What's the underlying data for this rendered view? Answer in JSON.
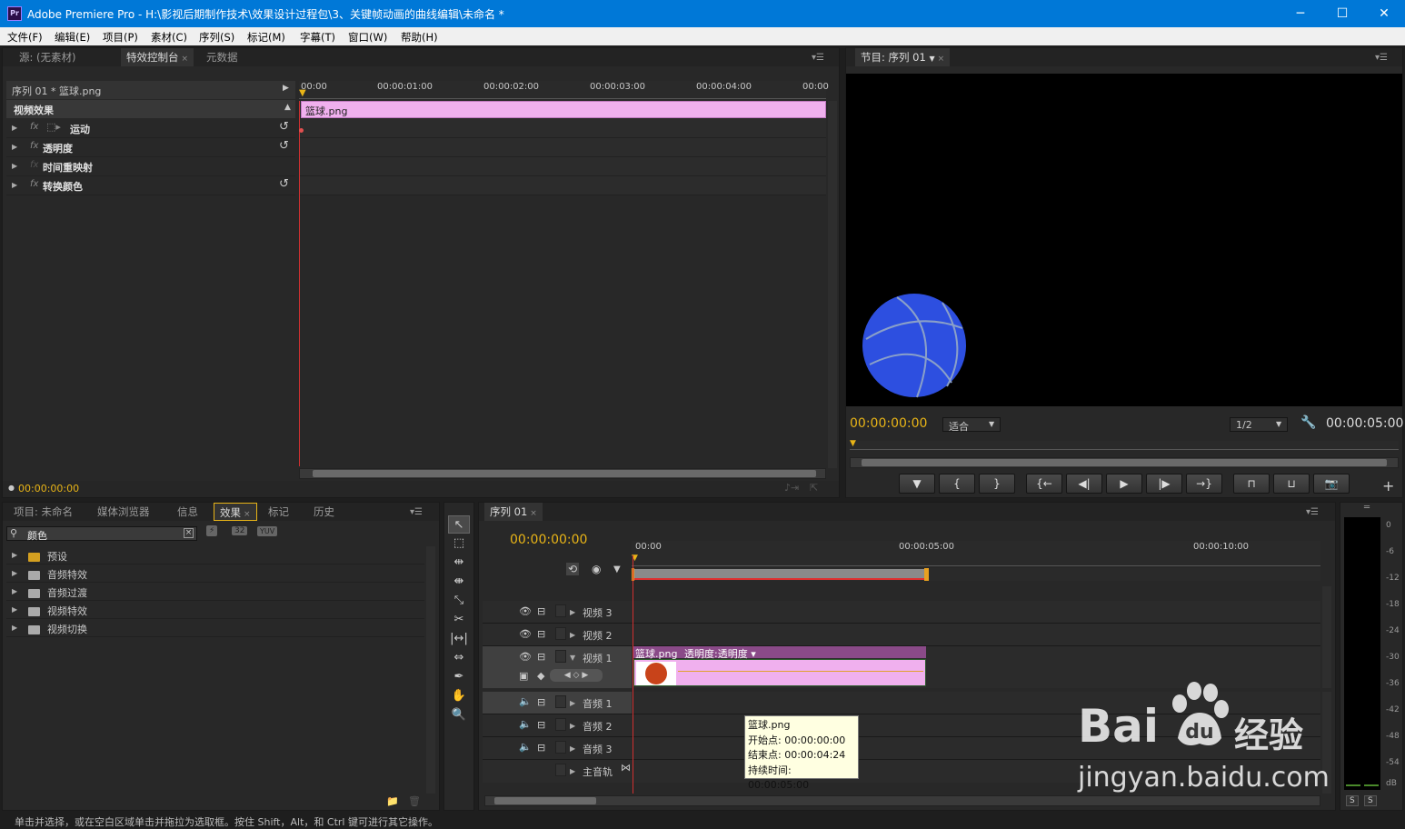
{
  "window": {
    "app_icon": "Pr",
    "title": "Adobe Premiere Pro - H:\\影视后期制作技术\\效果设计过程包\\3、关键帧动画的曲线编辑\\未命名 *",
    "minimize": "─",
    "maximize": "☐",
    "close": "✕"
  },
  "menu": [
    "文件(F)",
    "编辑(E)",
    "项目(P)",
    "素材(C)",
    "序列(S)",
    "标记(M)",
    "字幕(T)",
    "窗口(W)",
    "帮助(H)"
  ],
  "effect_controls": {
    "tabs": [
      "源: (无素材)",
      "特效控制台",
      "元数据"
    ],
    "clip_path": "序列 01 * 篮球.png",
    "ruler": [
      "00:00",
      "00:00:01:00",
      "00:00:02:00",
      "00:00:03:00",
      "00:00:04:00",
      "00:00"
    ],
    "clip_label": "篮球.png",
    "section": "视频效果",
    "effects": [
      {
        "name": "运动"
      },
      {
        "name": "透明度"
      },
      {
        "name": "时间重映射"
      },
      {
        "name": "转换颜色"
      }
    ],
    "fx_label": "fx",
    "timecode": "00:00:00:00"
  },
  "program": {
    "tab": "节目: 序列 01",
    "timecode": "00:00:00:00",
    "fit": "适合",
    "resolution": "1/2",
    "duration": "00:00:05:00"
  },
  "project": {
    "tabs": [
      "项目: 未命名",
      "媒体浏览器",
      "信息",
      "效果",
      "标记",
      "历史"
    ],
    "search_value": "颜色",
    "buttons": [
      "32",
      "YUV"
    ],
    "folders": [
      "预设",
      "音频特效",
      "音频过渡",
      "视频特效",
      "视频切换"
    ]
  },
  "sequence": {
    "tab": "序列 01",
    "timecode": "00:00:00:00",
    "ruler": [
      "00:00",
      "00:00:05:00",
      "00:00:10:00"
    ],
    "video_tracks": [
      "视频 3",
      "视频 2",
      "视频 1"
    ],
    "audio_tracks": [
      "音频 1",
      "音频 2",
      "音频 3"
    ],
    "master": "主音轨",
    "clip_name": "篮球.png",
    "clip_effect": "透明度:透明度",
    "tooltip": [
      "篮球.png",
      "开始点: 00:00:00:00",
      "结束点: 00:00:04:24",
      "持续时间: 00:00:05:00"
    ]
  },
  "meter": {
    "labels": [
      "0",
      "-6",
      "-12",
      "-18",
      "-24",
      "-30",
      "-36",
      "-42",
      "-48",
      "-54",
      "dB"
    ],
    "solo": [
      "S",
      "S"
    ]
  },
  "statusbar": "单击并选择，或在空白区域单击并拖拉为选取框。按住 Shift，Alt，和 Ctrl 键可进行其它操作。",
  "watermark": {
    "brand": "Bai",
    "brand2": "经验",
    "url": "jingyan.baidu.com"
  },
  "colors": {
    "accent": "#e8b417",
    "clip_pink": "#f0b0ee",
    "clip_header": "#8a4a88",
    "ball": "#2d4fe0",
    "titlebar": "#0078d7"
  }
}
